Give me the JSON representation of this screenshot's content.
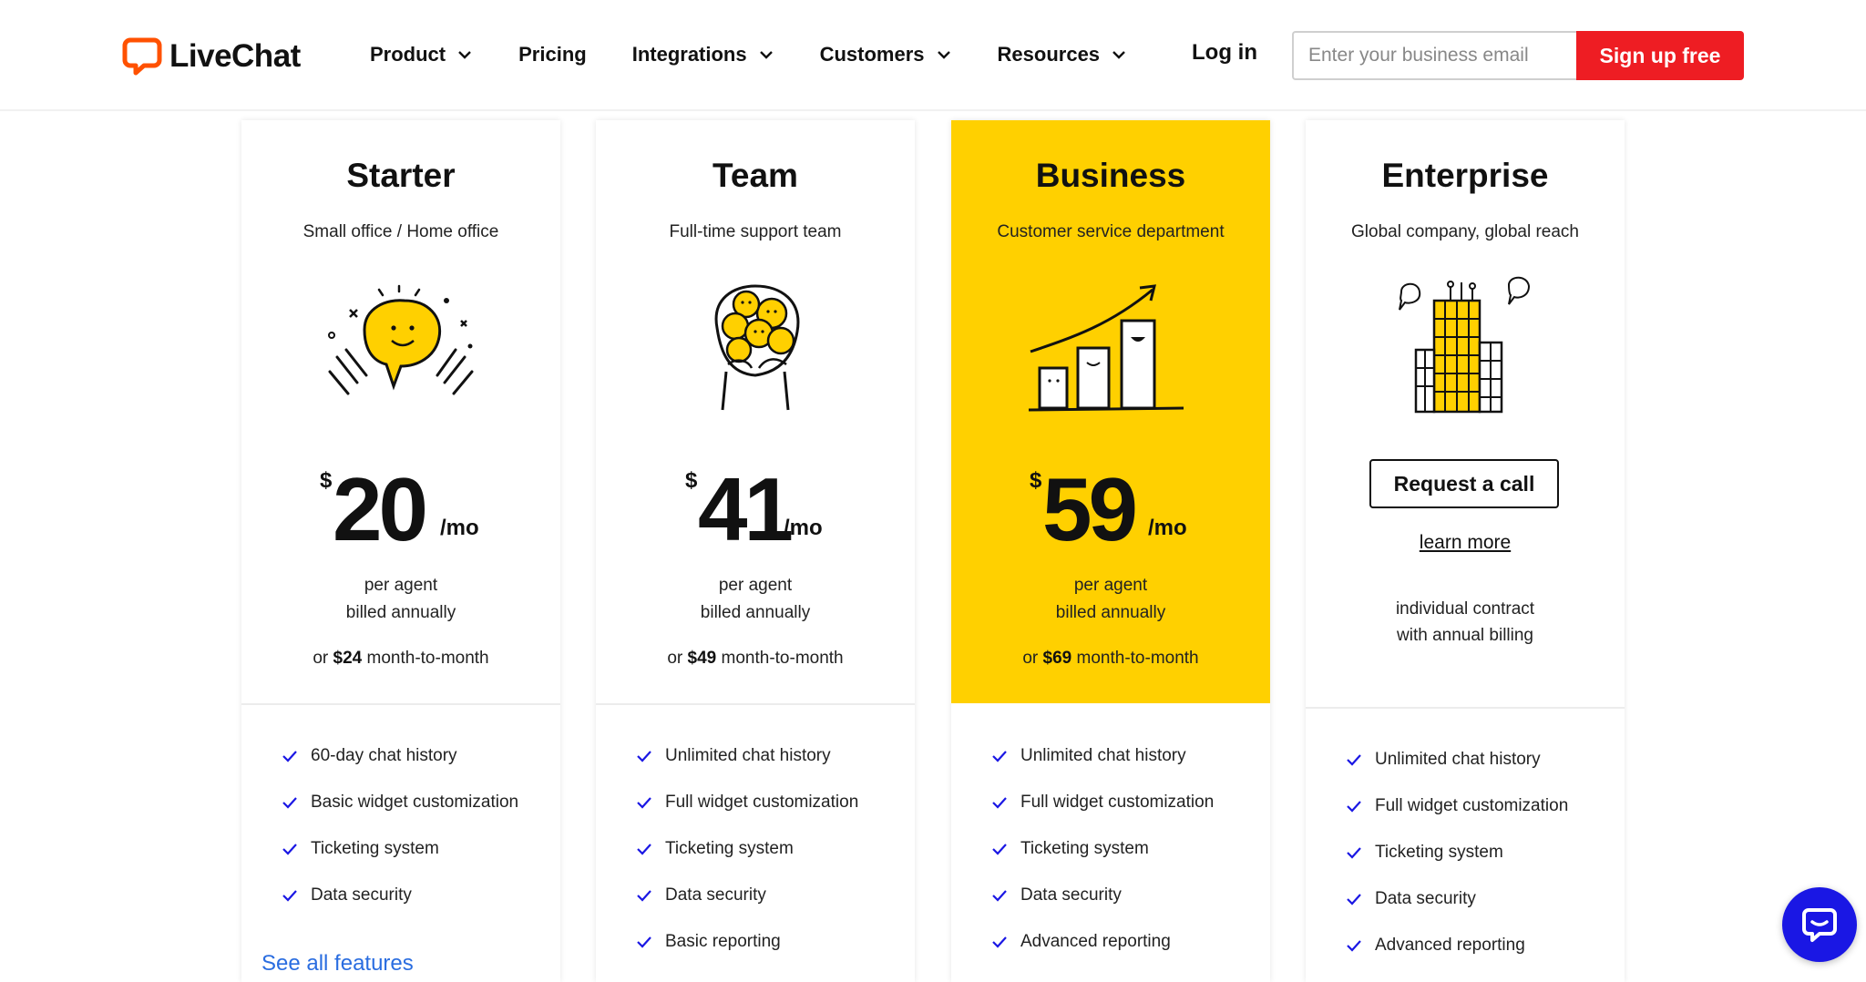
{
  "brand": {
    "name": "LiveChat",
    "accent_color": "#ff5100",
    "cta_color": "#ee1d23",
    "featured_color": "#ffd000",
    "link_color": "#2a6de0",
    "chat_widget_color": "#1a17e4"
  },
  "nav": {
    "items": [
      {
        "label": "Product",
        "has_dropdown": true
      },
      {
        "label": "Pricing",
        "has_dropdown": false
      },
      {
        "label": "Integrations",
        "has_dropdown": true
      },
      {
        "label": "Customers",
        "has_dropdown": true
      },
      {
        "label": "Resources",
        "has_dropdown": true
      }
    ],
    "login": "Log in",
    "email_placeholder": "Enter your business email",
    "signup": "Sign up free"
  },
  "plans": [
    {
      "name": "Starter",
      "subtitle": "Small office / Home office",
      "illustration": "speech-bubble-illustration",
      "currency": "$",
      "price": "20",
      "per": "/mo",
      "billing_1": "per agent",
      "billing_2": "billed annually",
      "mtm_prefix": "or",
      "mtm_price": "$24",
      "mtm_suffix": "month-to-month",
      "features": [
        "60-day chat history",
        "Basic widget customization",
        "Ticketing system",
        "Data security"
      ],
      "see_all": "See all features"
    },
    {
      "name": "Team",
      "subtitle": "Full-time support team",
      "illustration": "team-group-illustration",
      "currency": "$",
      "price": "41",
      "per": "/mo",
      "billing_1": "per agent",
      "billing_2": "billed annually",
      "mtm_prefix": "or",
      "mtm_price": "$49",
      "mtm_suffix": "month-to-month",
      "features": [
        "Unlimited chat history",
        "Full widget customization",
        "Ticketing system",
        "Data security",
        "Basic reporting"
      ]
    },
    {
      "name": "Business",
      "subtitle": "Customer service department",
      "illustration": "growth-chart-illustration",
      "featured": true,
      "currency": "$",
      "price": "59",
      "per": "/mo",
      "billing_1": "per agent",
      "billing_2": "billed annually",
      "mtm_prefix": "or",
      "mtm_price": "$69",
      "mtm_suffix": "month-to-month",
      "features": [
        "Unlimited chat history",
        "Full widget customization",
        "Ticketing system",
        "Data security",
        "Advanced reporting"
      ]
    },
    {
      "name": "Enterprise",
      "subtitle": "Global company, global reach",
      "illustration": "skyscraper-illustration",
      "cta": "Request a call",
      "learn_more": "learn more",
      "contract_1": "individual contract",
      "contract_2": "with annual billing",
      "features": [
        "Unlimited chat history",
        "Full widget customization",
        "Ticketing system",
        "Data security",
        "Advanced reporting"
      ]
    }
  ],
  "icons": {
    "check": "check-icon",
    "chevron": "chevron-down-icon",
    "chat_widget": "chat-icon"
  }
}
